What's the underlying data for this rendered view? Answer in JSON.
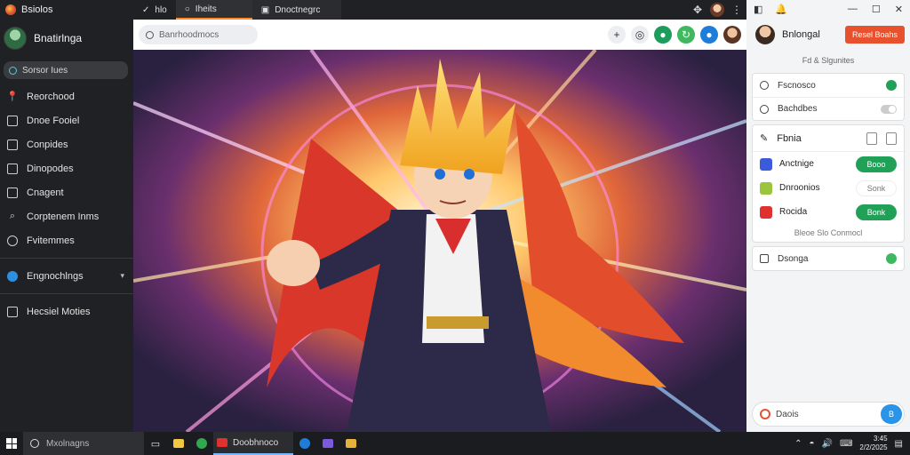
{
  "sidebar": {
    "app_title": "Bsiolos",
    "profile_name": "Bnatirlnga",
    "search_label": "Sorsor Iues",
    "items": [
      {
        "label": "Reorchood",
        "icon": "pin-icon"
      },
      {
        "label": "Dnoe Fooiel",
        "icon": "square-icon"
      },
      {
        "label": "Conpides",
        "icon": "box-icon"
      },
      {
        "label": "Dinopodes",
        "icon": "camera-icon"
      },
      {
        "label": "Cnagent",
        "icon": "image-icon"
      },
      {
        "label": "Corptenem Inms",
        "icon": "search-icon"
      },
      {
        "label": "Fvitemmes",
        "icon": "clock-icon"
      }
    ],
    "group_label": "Engnochlngs",
    "footer_label": "Hecsiel Moties"
  },
  "tabs": [
    {
      "label": "hlo",
      "icon": "check-icon"
    },
    {
      "label": "Iheits",
      "icon": "circle-icon"
    },
    {
      "label": "Dnoctnegrc",
      "icon": "image-icon"
    }
  ],
  "addressbar": {
    "url_text": "Banrhoodmocs"
  },
  "rightpanel": {
    "profile_name": "Bnlongal",
    "action_button": "Resel Boahs",
    "subtitle": "Fd & Slgunites",
    "settings": [
      {
        "label": "Fscnosco",
        "control": "dot"
      },
      {
        "label": "Bachdbes",
        "control": "toggle"
      }
    ],
    "card_title": "Fbnia",
    "services": [
      {
        "label": "Anctnige",
        "button": "Booo",
        "color": "#3b5bdb",
        "style": "green"
      },
      {
        "label": "Dnroonios",
        "button": "Sonk",
        "color": "#9bc53d",
        "style": "white"
      },
      {
        "label": "Rocida",
        "button": "Bonk",
        "color": "#e03131",
        "style": "green"
      }
    ],
    "note": "Bleoe Slo Conmocl",
    "extra_row": "Dsonga",
    "chat_placeholder": "Daois",
    "send_label": "B"
  },
  "taskbar": {
    "search_placeholder": "Mxolnagns",
    "active_app": "Doobhnoco",
    "time": "3:45",
    "date": "2/2/2025"
  }
}
